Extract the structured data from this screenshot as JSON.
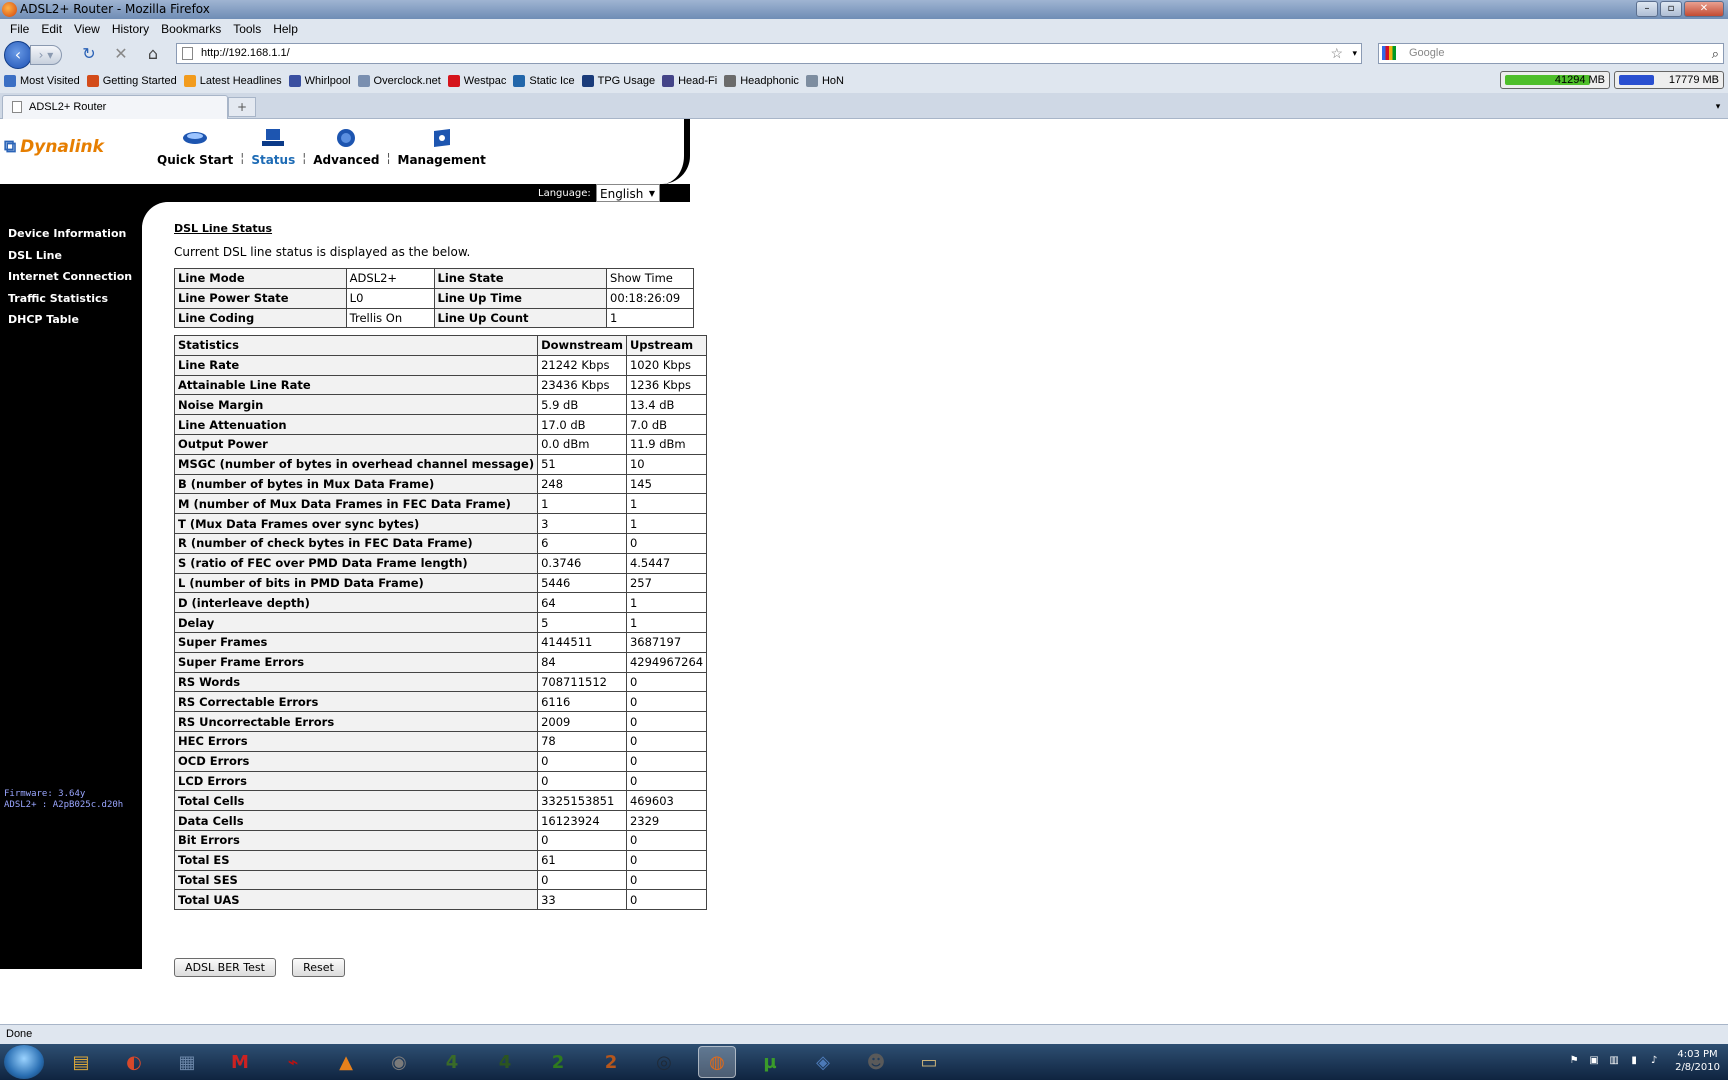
{
  "window": {
    "title": "ADSL2+ Router - Mozilla Firefox"
  },
  "menu": [
    "File",
    "Edit",
    "View",
    "History",
    "Bookmarks",
    "Tools",
    "Help"
  ],
  "url": "http://192.168.1.1/",
  "search_placeholder": "Google",
  "bookmarks": [
    {
      "label": "Most Visited",
      "color": "#3b6fc4"
    },
    {
      "label": "Getting Started",
      "color": "#d34b19"
    },
    {
      "label": "Latest Headlines",
      "color": "#f29b1d"
    },
    {
      "label": "Whirlpool",
      "color": "#3a4fa0"
    },
    {
      "label": "Overclock.net",
      "color": "#7a8fb0"
    },
    {
      "label": "Westpac",
      "color": "#d5131b"
    },
    {
      "label": "Static Ice",
      "color": "#2266aa"
    },
    {
      "label": "TPG Usage",
      "color": "#1a3b7a"
    },
    {
      "label": "Head-Fi",
      "color": "#444488"
    },
    {
      "label": "Headphonic",
      "color": "#6b6b6b"
    },
    {
      "label": "HoN",
      "color": "#7d8da0"
    }
  ],
  "meters": [
    {
      "label": "41294 MB",
      "color": "#4fbf2a",
      "level": 0.85
    },
    {
      "label": "17779 MB",
      "color": "#2a4fd0",
      "level": 0.35
    }
  ],
  "tab": {
    "label": "ADSL2+ Router",
    "new_tab": "+"
  },
  "router": {
    "logo": "Dynalink",
    "nav": [
      {
        "label": "Quick Start",
        "active": false
      },
      {
        "label": "Status",
        "active": true
      },
      {
        "label": "Advanced",
        "active": false
      },
      {
        "label": "Management",
        "active": false
      }
    ],
    "nav_sep": "¦",
    "language_label": "Language:",
    "language_value": "English",
    "sidebar": [
      "Device Information",
      "DSL Line",
      "Internet Connection",
      "Traffic Statistics",
      "DHCP Table"
    ],
    "firmware": "Firmware: 3.64y",
    "adsl_version": "ADSL2+ : A2pB025c.d20h",
    "section_title": "DSL Line Status",
    "section_desc": "Current DSL line status is displayed as the below.",
    "line_table": [
      [
        "Line Mode",
        "ADSL2+",
        "Line State",
        "Show Time"
      ],
      [
        "Line Power State",
        "L0",
        "Line Up Time",
        "00:18:26:09"
      ],
      [
        "Line Coding",
        "Trellis On",
        "Line Up Count",
        "1"
      ]
    ],
    "stats_header": [
      "Statistics",
      "Downstream",
      "Upstream"
    ],
    "stats": [
      [
        "Line Rate",
        "21242 Kbps",
        "1020 Kbps"
      ],
      [
        "Attainable Line Rate",
        "23436 Kbps",
        "1236 Kbps"
      ],
      [
        "Noise Margin",
        "5.9 dB",
        "13.4 dB"
      ],
      [
        "Line Attenuation",
        "17.0 dB",
        "7.0 dB"
      ],
      [
        "Output Power",
        "0.0 dBm",
        "11.9 dBm"
      ],
      [
        "MSGC (number of bytes in overhead channel message)",
        "51",
        "10"
      ],
      [
        "B (number of bytes in Mux Data Frame)",
        "248",
        "145"
      ],
      [
        "M (number of Mux Data Frames in FEC Data Frame)",
        "1",
        "1"
      ],
      [
        "T (Mux Data Frames over sync bytes)",
        "3",
        "1"
      ],
      [
        "R (number of check bytes in FEC Data Frame)",
        "6",
        "0"
      ],
      [
        "S (ratio of FEC over PMD Data Frame length)",
        "0.3746",
        "4.5447"
      ],
      [
        "L (number of bits in PMD Data Frame)",
        "5446",
        "257"
      ],
      [
        "D (interleave depth)",
        "64",
        "1"
      ],
      [
        "Delay",
        "5",
        "1"
      ],
      [
        "Super Frames",
        "4144511",
        "3687197"
      ],
      [
        "Super Frame Errors",
        "84",
        "4294967264"
      ],
      [
        "RS Words",
        "708711512",
        "0"
      ],
      [
        "RS Correctable Errors",
        "6116",
        "0"
      ],
      [
        "RS Uncorrectable Errors",
        "2009",
        "0"
      ],
      [
        "HEC Errors",
        "78",
        "0"
      ],
      [
        "OCD Errors",
        "0",
        "0"
      ],
      [
        "LCD Errors",
        "0",
        "0"
      ],
      [
        "Total Cells",
        "3325153851",
        "469603"
      ],
      [
        "Data Cells",
        "16123924",
        "2329"
      ],
      [
        "Bit Errors",
        "0",
        "0"
      ],
      [
        "Total ES",
        "61",
        "0"
      ],
      [
        "Total SES",
        "0",
        "0"
      ],
      [
        "Total UAS",
        "33",
        "0"
      ]
    ],
    "buttons": {
      "ber_test": "ADSL BER Test",
      "reset": "Reset"
    }
  },
  "status": "Done",
  "taskbar": {
    "icons": [
      {
        "name": "explorer-icon",
        "glyph": "▤",
        "bg": "#d9a63a"
      },
      {
        "name": "chrome-like-icon",
        "glyph": "◐",
        "bg": "#d8482a"
      },
      {
        "name": "scanner-icon",
        "glyph": "▦",
        "bg": "#6b86a8"
      },
      {
        "name": "gmail-icon",
        "glyph": "M",
        "bg": "#c22"
      },
      {
        "name": "acrobat-icon",
        "glyph": "⌁",
        "bg": "#b11"
      },
      {
        "name": "vlc-icon",
        "glyph": "▲",
        "bg": "#e7811c"
      },
      {
        "name": "media-icon",
        "glyph": "◉",
        "bg": "#7a7a7a"
      },
      {
        "name": "game1-icon",
        "glyph": "4",
        "bg": "#3a6b28"
      },
      {
        "name": "game2-icon",
        "glyph": "4",
        "bg": "#2c5520"
      },
      {
        "name": "game3-icon",
        "glyph": "2",
        "bg": "#2f7a1e"
      },
      {
        "name": "game4-icon",
        "glyph": "2",
        "bg": "#b5561c"
      },
      {
        "name": "steam-icon",
        "glyph": "◎",
        "bg": "#1f2a38"
      },
      {
        "name": "firefox-icon",
        "glyph": "◍",
        "bg": "#e06a1a"
      },
      {
        "name": "utorrent-icon",
        "glyph": "µ",
        "bg": "#3a9b2a"
      },
      {
        "name": "network-icon",
        "glyph": "◈",
        "bg": "#4c7ab8"
      },
      {
        "name": "alien-icon",
        "glyph": "☻",
        "bg": "#5a5a5a"
      },
      {
        "name": "folder-icon",
        "glyph": "▭",
        "bg": "#c9b27a"
      }
    ],
    "time": "4:03 PM",
    "date": "2/8/2010"
  }
}
